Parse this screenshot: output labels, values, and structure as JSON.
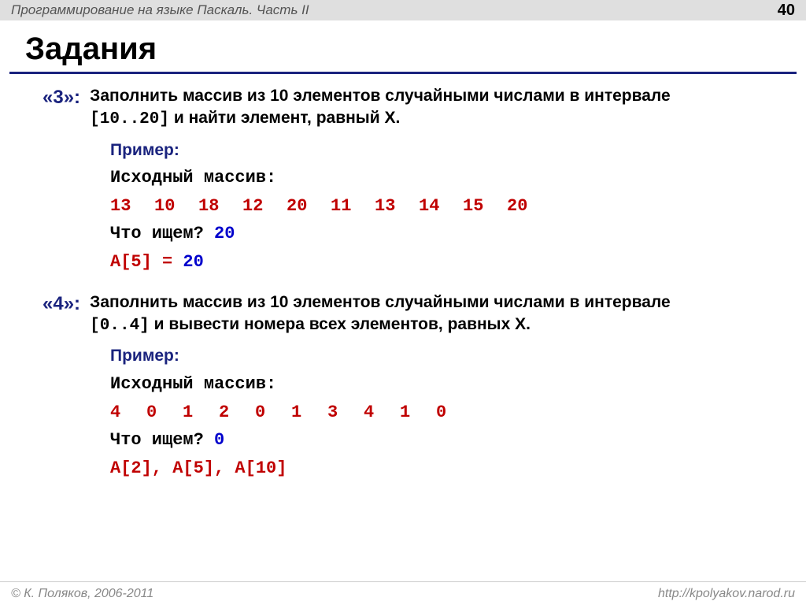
{
  "header": {
    "title": "Программирование на языке Паскаль. Часть II",
    "page": "40"
  },
  "slide_title": "Задания",
  "tasks": [
    {
      "grade": "«3»:",
      "desc_pre": "Заполнить массив из 10 элементов случайными числами в интервале ",
      "desc_code": "[10..20]",
      "desc_post": " и найти элемент, равный X.",
      "example_label": "Пример:",
      "src_label": "Исходный массив:",
      "array": [
        "13",
        "10",
        "18",
        "12",
        "20",
        "11",
        "13",
        "14",
        "15",
        "20"
      ],
      "prompt_label": "Что ищем? ",
      "prompt_value": "20",
      "result_lhs": "A[5] = ",
      "result_rhs": "20"
    },
    {
      "grade": "«4»:",
      "desc_pre": "Заполнить массив из 10 элементов случайными числами в интервале ",
      "desc_code": "[0..4]",
      "desc_post": " и вывести номера всех элементов, равных X.",
      "example_label": "Пример:",
      "src_label": "Исходный массив:",
      "array": [
        "4",
        "0",
        "1",
        "2",
        "0",
        "1",
        "3",
        "4",
        "1",
        "0"
      ],
      "prompt_label": "Что ищем? ",
      "prompt_value": "0",
      "result_full": "A[2], A[5], A[10]"
    }
  ],
  "footer": {
    "left": "© К. Поляков, 2006-2011",
    "right": "http://kpolyakov.narod.ru"
  }
}
